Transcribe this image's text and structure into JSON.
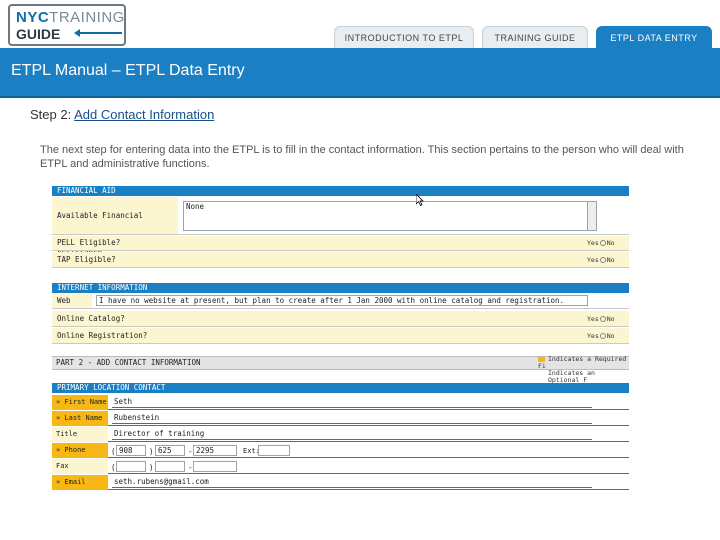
{
  "logo": {
    "line1_bold": "NYC",
    "line1_light": "TRAINING",
    "line2": "GUIDE"
  },
  "tabs": [
    "INTRODUCTION TO ETPL",
    "TRAINING GUIDE",
    "ETPL DATA ENTRY"
  ],
  "page_title": "ETPL Manual – ETPL Data Entry",
  "step": {
    "prefix": "Step 2:",
    "link": "Add Contact Information"
  },
  "intro": "The next step for entering data into the ETPL is to fill in the contact information. This section pertains to the person who will deal with ETPL and administrative functions.",
  "form": {
    "financial_aid": {
      "header": "FINANCIAL AID",
      "available_label": "Available Financial Assistance",
      "available_value": "None",
      "pell_label": "PELL Eligible?",
      "tap_label": "TAP Eligible?",
      "yes": "Yes",
      "no": "No"
    },
    "internet": {
      "header": "INTERNET INFORMATION",
      "website_label": "Web Site:",
      "website_value": "I have no website at present, but plan to create after 1 Jan 2000 with online catalog and registration.",
      "catalog_label": "Online Catalog?",
      "registration_label": "Online Registration?"
    },
    "part2": {
      "title": "PART 2 - ADD CONTACT INFORMATION",
      "legend_required": "Indicates a Required Fi",
      "legend_optional": "Indicates an Optional F"
    },
    "primary": {
      "header": "PRIMARY LOCATION CONTACT",
      "first_name_label": "» First Name",
      "first_name": "Seth",
      "last_name_label": "» Last Name",
      "last_name": "Rubenstein",
      "title_label": "Title",
      "title": "Director of training",
      "phone_label": "» Phone",
      "phone_open": "(",
      "phone_area": "908",
      "phone_close": ")",
      "phone_prefix": "625",
      "phone_dash": "-",
      "phone_line": "2295",
      "ext_label": "Ext:",
      "fax_label": "Fax",
      "email_label": "» Email",
      "email": "seth.rubens@gmail.com"
    }
  }
}
